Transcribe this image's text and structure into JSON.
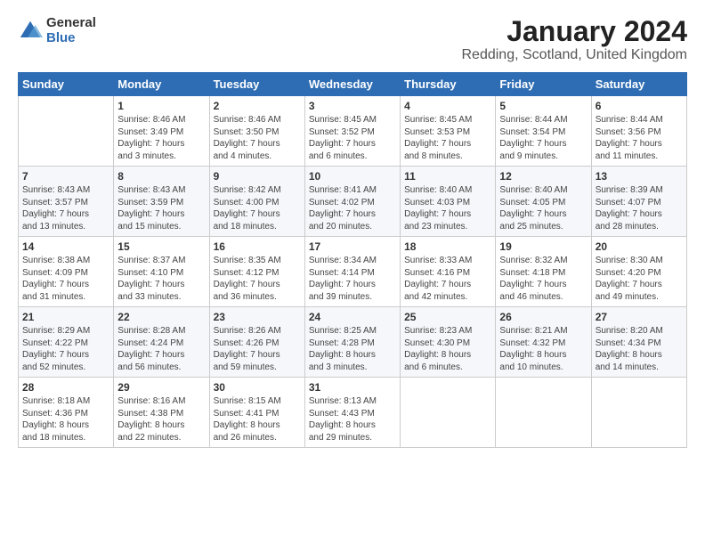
{
  "logo": {
    "general": "General",
    "blue": "Blue"
  },
  "title": "January 2024",
  "subtitle": "Redding, Scotland, United Kingdom",
  "days_of_week": [
    "Sunday",
    "Monday",
    "Tuesday",
    "Wednesday",
    "Thursday",
    "Friday",
    "Saturday"
  ],
  "weeks": [
    [
      {
        "day": "",
        "info": ""
      },
      {
        "day": "1",
        "info": "Sunrise: 8:46 AM\nSunset: 3:49 PM\nDaylight: 7 hours\nand 3 minutes."
      },
      {
        "day": "2",
        "info": "Sunrise: 8:46 AM\nSunset: 3:50 PM\nDaylight: 7 hours\nand 4 minutes."
      },
      {
        "day": "3",
        "info": "Sunrise: 8:45 AM\nSunset: 3:52 PM\nDaylight: 7 hours\nand 6 minutes."
      },
      {
        "day": "4",
        "info": "Sunrise: 8:45 AM\nSunset: 3:53 PM\nDaylight: 7 hours\nand 8 minutes."
      },
      {
        "day": "5",
        "info": "Sunrise: 8:44 AM\nSunset: 3:54 PM\nDaylight: 7 hours\nand 9 minutes."
      },
      {
        "day": "6",
        "info": "Sunrise: 8:44 AM\nSunset: 3:56 PM\nDaylight: 7 hours\nand 11 minutes."
      }
    ],
    [
      {
        "day": "7",
        "info": "Sunrise: 8:43 AM\nSunset: 3:57 PM\nDaylight: 7 hours\nand 13 minutes."
      },
      {
        "day": "8",
        "info": "Sunrise: 8:43 AM\nSunset: 3:59 PM\nDaylight: 7 hours\nand 15 minutes."
      },
      {
        "day": "9",
        "info": "Sunrise: 8:42 AM\nSunset: 4:00 PM\nDaylight: 7 hours\nand 18 minutes."
      },
      {
        "day": "10",
        "info": "Sunrise: 8:41 AM\nSunset: 4:02 PM\nDaylight: 7 hours\nand 20 minutes."
      },
      {
        "day": "11",
        "info": "Sunrise: 8:40 AM\nSunset: 4:03 PM\nDaylight: 7 hours\nand 23 minutes."
      },
      {
        "day": "12",
        "info": "Sunrise: 8:40 AM\nSunset: 4:05 PM\nDaylight: 7 hours\nand 25 minutes."
      },
      {
        "day": "13",
        "info": "Sunrise: 8:39 AM\nSunset: 4:07 PM\nDaylight: 7 hours\nand 28 minutes."
      }
    ],
    [
      {
        "day": "14",
        "info": "Sunrise: 8:38 AM\nSunset: 4:09 PM\nDaylight: 7 hours\nand 31 minutes."
      },
      {
        "day": "15",
        "info": "Sunrise: 8:37 AM\nSunset: 4:10 PM\nDaylight: 7 hours\nand 33 minutes."
      },
      {
        "day": "16",
        "info": "Sunrise: 8:35 AM\nSunset: 4:12 PM\nDaylight: 7 hours\nand 36 minutes."
      },
      {
        "day": "17",
        "info": "Sunrise: 8:34 AM\nSunset: 4:14 PM\nDaylight: 7 hours\nand 39 minutes."
      },
      {
        "day": "18",
        "info": "Sunrise: 8:33 AM\nSunset: 4:16 PM\nDaylight: 7 hours\nand 42 minutes."
      },
      {
        "day": "19",
        "info": "Sunrise: 8:32 AM\nSunset: 4:18 PM\nDaylight: 7 hours\nand 46 minutes."
      },
      {
        "day": "20",
        "info": "Sunrise: 8:30 AM\nSunset: 4:20 PM\nDaylight: 7 hours\nand 49 minutes."
      }
    ],
    [
      {
        "day": "21",
        "info": "Sunrise: 8:29 AM\nSunset: 4:22 PM\nDaylight: 7 hours\nand 52 minutes."
      },
      {
        "day": "22",
        "info": "Sunrise: 8:28 AM\nSunset: 4:24 PM\nDaylight: 7 hours\nand 56 minutes."
      },
      {
        "day": "23",
        "info": "Sunrise: 8:26 AM\nSunset: 4:26 PM\nDaylight: 7 hours\nand 59 minutes."
      },
      {
        "day": "24",
        "info": "Sunrise: 8:25 AM\nSunset: 4:28 PM\nDaylight: 8 hours\nand 3 minutes."
      },
      {
        "day": "25",
        "info": "Sunrise: 8:23 AM\nSunset: 4:30 PM\nDaylight: 8 hours\nand 6 minutes."
      },
      {
        "day": "26",
        "info": "Sunrise: 8:21 AM\nSunset: 4:32 PM\nDaylight: 8 hours\nand 10 minutes."
      },
      {
        "day": "27",
        "info": "Sunrise: 8:20 AM\nSunset: 4:34 PM\nDaylight: 8 hours\nand 14 minutes."
      }
    ],
    [
      {
        "day": "28",
        "info": "Sunrise: 8:18 AM\nSunset: 4:36 PM\nDaylight: 8 hours\nand 18 minutes."
      },
      {
        "day": "29",
        "info": "Sunrise: 8:16 AM\nSunset: 4:38 PM\nDaylight: 8 hours\nand 22 minutes."
      },
      {
        "day": "30",
        "info": "Sunrise: 8:15 AM\nSunset: 4:41 PM\nDaylight: 8 hours\nand 26 minutes."
      },
      {
        "day": "31",
        "info": "Sunrise: 8:13 AM\nSunset: 4:43 PM\nDaylight: 8 hours\nand 29 minutes."
      },
      {
        "day": "",
        "info": ""
      },
      {
        "day": "",
        "info": ""
      },
      {
        "day": "",
        "info": ""
      }
    ]
  ]
}
